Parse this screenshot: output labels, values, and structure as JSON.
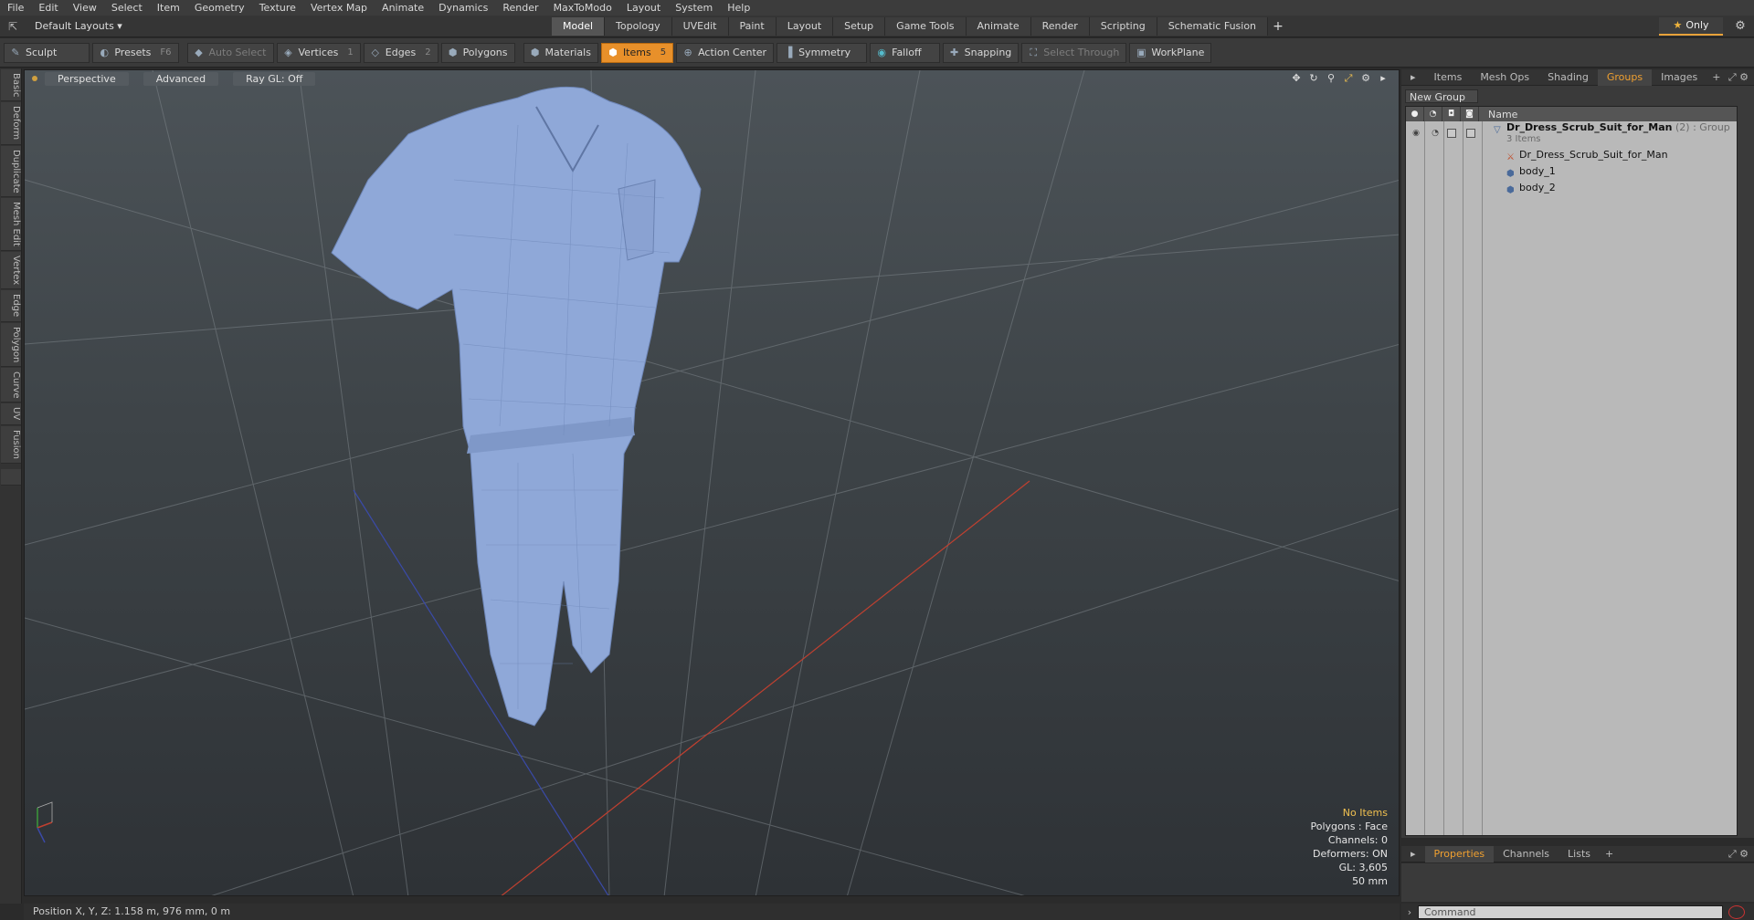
{
  "menu": [
    "File",
    "Edit",
    "View",
    "Select",
    "Item",
    "Geometry",
    "Texture",
    "Vertex Map",
    "Animate",
    "Dynamics",
    "Render",
    "MaxToModo",
    "Layout",
    "System",
    "Help"
  ],
  "layout": {
    "dropdown": "Default Layouts ▾",
    "mode_tabs": [
      "Model",
      "Topology",
      "UVEdit",
      "Paint",
      "Layout",
      "Setup",
      "Game Tools",
      "Animate",
      "Render",
      "Scripting",
      "Schematic Fusion"
    ],
    "active_mode": "Model",
    "only_label": "Only"
  },
  "toolbar": {
    "sculpt": "Sculpt",
    "presets": "Presets",
    "presets_key": "F6",
    "auto_select": "Auto Select",
    "vertices": "Vertices",
    "vertices_key": "1",
    "edges": "Edges",
    "edges_key": "2",
    "polygons": "Polygons",
    "materials": "Materials",
    "items": "Items",
    "items_key": "5",
    "action_center": "Action Center",
    "symmetry": "Symmetry",
    "falloff": "Falloff",
    "snapping": "Snapping",
    "select_through": "Select Through",
    "workplane": "WorkPlane"
  },
  "left_tabs": [
    "Basic",
    "Deform",
    "Duplicate",
    "Mesh Edit",
    "Vertex",
    "Edge",
    "Polygon",
    "Curve",
    "UV",
    "Fusion"
  ],
  "viewport": {
    "perspective": "Perspective",
    "advanced": "Advanced",
    "raygl": "Ray GL: Off",
    "info": {
      "no_items": "No Items",
      "polygons": "Polygons : Face",
      "channels": "Channels: 0",
      "deformers": "Deformers: ON",
      "gl": "GL: 3,605",
      "focal": "50 mm"
    }
  },
  "status": {
    "position": "Position X, Y, Z:   1.158 m, 976 mm, 0 m"
  },
  "right_panel": {
    "tabs": [
      "Items",
      "Mesh Ops",
      "Shading",
      "Groups",
      "Images"
    ],
    "active_tab": "Groups",
    "new_group": "New Group",
    "col_name": "Name",
    "group": {
      "name": "Dr_Dress_Scrub_Suit_for_Man",
      "count": "(2)",
      "type": ": Group",
      "items_count": "3 Items",
      "children": [
        "Dr_Dress_Scrub_Suit_for_Man",
        "body_1",
        "body_2"
      ]
    },
    "bottom_tabs": [
      "Properties",
      "Channels",
      "Lists"
    ],
    "active_bottom_tab": "Properties",
    "command_placeholder": "Command"
  },
  "colors": {
    "accent": "#e8902a",
    "active_tab_text": "#f0a030",
    "mesh": "#8fa8d8"
  }
}
